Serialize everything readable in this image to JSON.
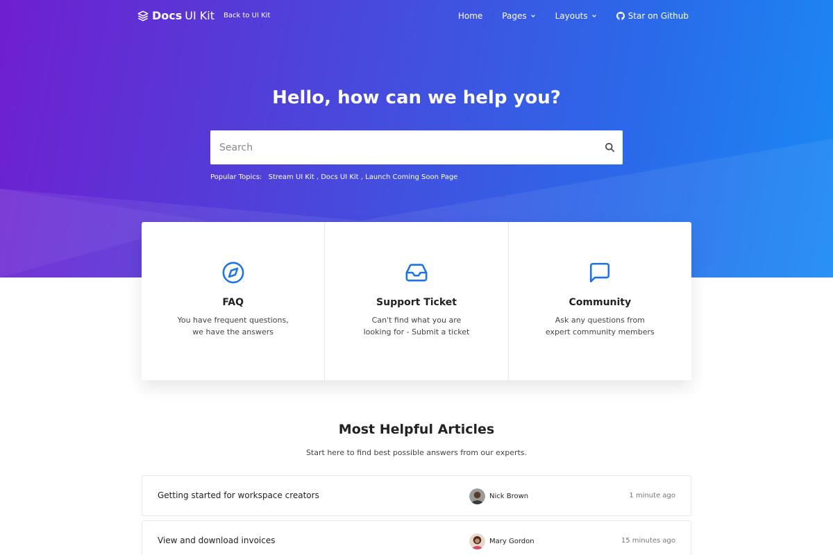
{
  "nav": {
    "brand_bold": "Docs",
    "brand_light": "UI Kit",
    "back_link": "Back to UI Kit",
    "links": [
      {
        "label": "Home"
      },
      {
        "label": "Pages"
      },
      {
        "label": "Layouts"
      },
      {
        "label": "Star on Github"
      }
    ]
  },
  "hero": {
    "title": "Hello, how can we help you?",
    "search_placeholder": "Search",
    "popular_label": "Popular Topics:",
    "popular_topics": "Stream UI Kit , Docs UI Kit , Launch Coming Soon Page"
  },
  "cards": [
    {
      "title": "FAQ",
      "line1": "You have frequent questions,",
      "line2": "we have the answers",
      "icon": "compass-icon"
    },
    {
      "title": "Support Ticket",
      "line1": "Can't find what you are",
      "line2": "looking for - Submit a ticket",
      "icon": "inbox-icon"
    },
    {
      "title": "Community",
      "line1": "Ask any questions from",
      "line2": "expert community members",
      "icon": "message-square-icon"
    }
  ],
  "articles_section": {
    "title": "Most Helpful Articles",
    "subtitle": "Start here to find best possible answers from our experts."
  },
  "articles": [
    {
      "title": "Getting started for workspace creators",
      "author": "Nick Brown",
      "time": "1 minute ago"
    },
    {
      "title": "View and download invoices",
      "author": "Mary Gordon",
      "time": "15 minutes ago"
    }
  ],
  "colors": {
    "accent": "#1a73e8",
    "hero_start": "#6f1fd0",
    "hero_end": "#1a8af4"
  }
}
